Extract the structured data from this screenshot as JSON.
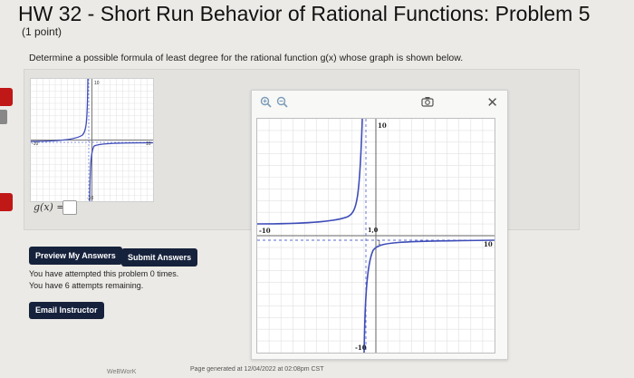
{
  "header": {
    "title": "HW 32 - Short Run Behavior of Rational Functions: Problem 5",
    "points": "(1 point)"
  },
  "problem": {
    "question": "Determine a possible formula of least degree for the rational function g(x) whose graph is shown below.",
    "answer_label": "g(x) =",
    "answer_value": ""
  },
  "mini_graph": {
    "tick_labels": [
      "10",
      "-10",
      "10",
      "-10"
    ]
  },
  "buttons": {
    "preview": "Preview My Answers",
    "submit": "Submit Answers",
    "email": "Email Instructor"
  },
  "status": {
    "attempted": "You have attempted this problem 0 times.",
    "remaining": "You have 6 attempts remaining."
  },
  "popup": {
    "zoom_in_icon": "zoom-in-icon",
    "zoom_out_icon": "zoom-out-icon",
    "camera_icon": "camera-icon",
    "close_glyph": "✕",
    "labels": {
      "y_top": "10",
      "x_left": "-10",
      "x_right": "10",
      "y_bottom": "-10",
      "unit_y": "1",
      "unit_x": "0",
      "point": "1,0"
    }
  },
  "footer": {
    "left": "WeBWorK",
    "generated": "Page generated at 12/04/2022 at 02:08pm CST"
  },
  "colors": {
    "button": "#16223c",
    "curve": "#3f4db8",
    "asymptote": "#5b6ad0",
    "accent_red": "#c01717"
  }
}
